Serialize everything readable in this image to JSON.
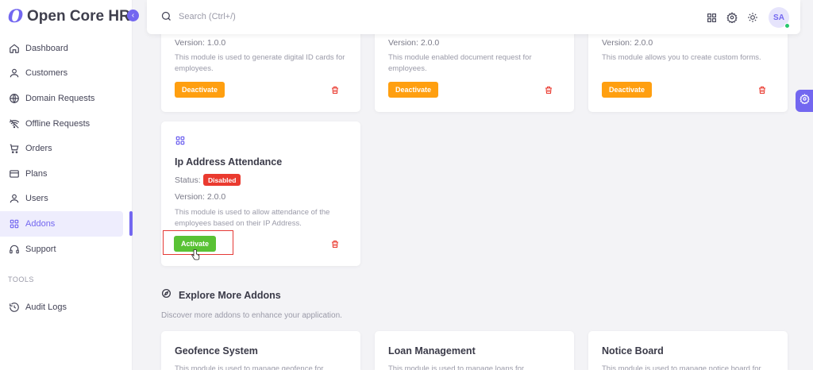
{
  "app": {
    "name": "Open Core HR"
  },
  "sidebar": {
    "items": [
      {
        "label": "Dashboard",
        "icon": "home-icon"
      },
      {
        "label": "Customers",
        "icon": "user-icon"
      },
      {
        "label": "Domain Requests",
        "icon": "globe-icon"
      },
      {
        "label": "Offline Requests",
        "icon": "wifi-off-icon"
      },
      {
        "label": "Orders",
        "icon": "cart-icon"
      },
      {
        "label": "Plans",
        "icon": "credit-card-icon"
      },
      {
        "label": "Users",
        "icon": "user-icon"
      },
      {
        "label": "Addons",
        "icon": "grid-icon",
        "active": true
      },
      {
        "label": "Support",
        "icon": "headset-icon"
      }
    ],
    "section_label": "TOOLS",
    "tools": [
      {
        "label": "Audit Logs",
        "icon": "history-icon"
      }
    ]
  },
  "topbar": {
    "search_placeholder": "Search (Ctrl+/)",
    "avatar_initials": "SA"
  },
  "top_cards": [
    {
      "version": "Version: 1.0.0",
      "description": "This module is used to generate digital ID cards for employees.",
      "button": "Deactivate"
    },
    {
      "version": "Version: 2.0.0",
      "description": "This module enabled document request for employees.",
      "button": "Deactivate"
    },
    {
      "version": "Version: 2.0.0",
      "description": "This module allows you to create custom forms.",
      "button": "Deactivate"
    }
  ],
  "ip_card": {
    "title": "Ip Address Attendance",
    "status_label": "Status:",
    "status": "Disabled",
    "version": "Version: 2.0.0",
    "description": "This module is used to allow attendance of the employees based on their IP Address.",
    "button": "Activate"
  },
  "explore": {
    "title": "Explore More Addons",
    "subtitle": "Discover more addons to enhance your application.",
    "cards": [
      {
        "title": "Geofence System",
        "description": "This module is used to manage geofence for"
      },
      {
        "title": "Loan Management",
        "description": "This module is used to manage loans for"
      },
      {
        "title": "Notice Board",
        "description": "This module is used to manage notice board for"
      }
    ]
  },
  "colors": {
    "primary": "#7367f0",
    "warning": "#ff9f10",
    "success": "#59c234",
    "danger": "#ea3a2f"
  }
}
